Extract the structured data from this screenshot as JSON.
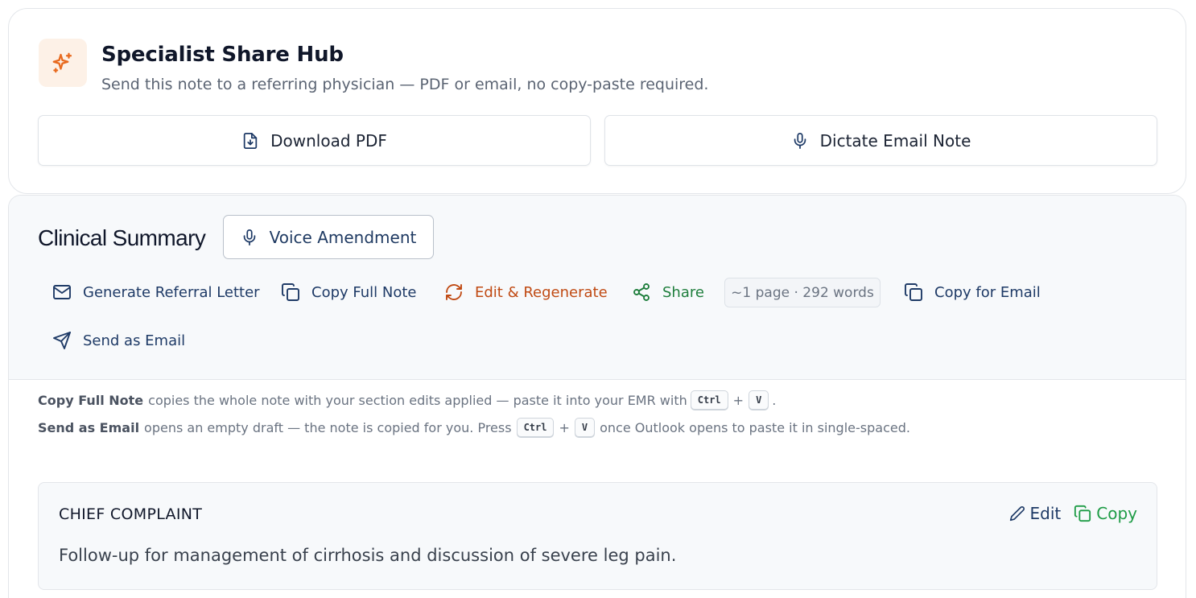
{
  "hub": {
    "title": "Specialist Share Hub",
    "subtitle": "Send this note to a referring physician — PDF or email, no copy-paste required.",
    "download_label": "Download PDF",
    "dictate_label": "Dictate Email Note",
    "badge_icon": "sparkles-icon",
    "accent": "#e8691e"
  },
  "summary": {
    "title": "Clinical Summary",
    "voice_label": "Voice Amendment",
    "actions": {
      "referral": "Generate Referral Letter",
      "copy_full": "Copy Full Note",
      "regenerate": "Edit & Regenerate",
      "share": "Share",
      "count": "~1 page · 292 words",
      "copy_email": "Copy for Email",
      "send_email": "Send as Email"
    },
    "help": {
      "line1_strong": "Copy Full Note",
      "line1_text": "copies the whole note with your section edits applied — paste it into your EMR with",
      "line2_strong": "Send as Email",
      "line2_text": "opens an empty draft — the note is copied for you. Press",
      "line2_tail": "once Outlook opens to paste it in single-spaced.",
      "key_ctrl": "Ctrl",
      "key_v": "V",
      "plus": "+",
      "period": "."
    }
  },
  "section": {
    "heading": "CHIEF COMPLAINT",
    "body": "Follow-up for management of cirrhosis and discussion of severe leg pain.",
    "edit_label": "Edit",
    "copy_label": "Copy"
  },
  "colors": {
    "navy": "#1e3a66",
    "orange": "#c04a13",
    "green": "#1e7e3c",
    "copy_green": "#1e9c46"
  }
}
